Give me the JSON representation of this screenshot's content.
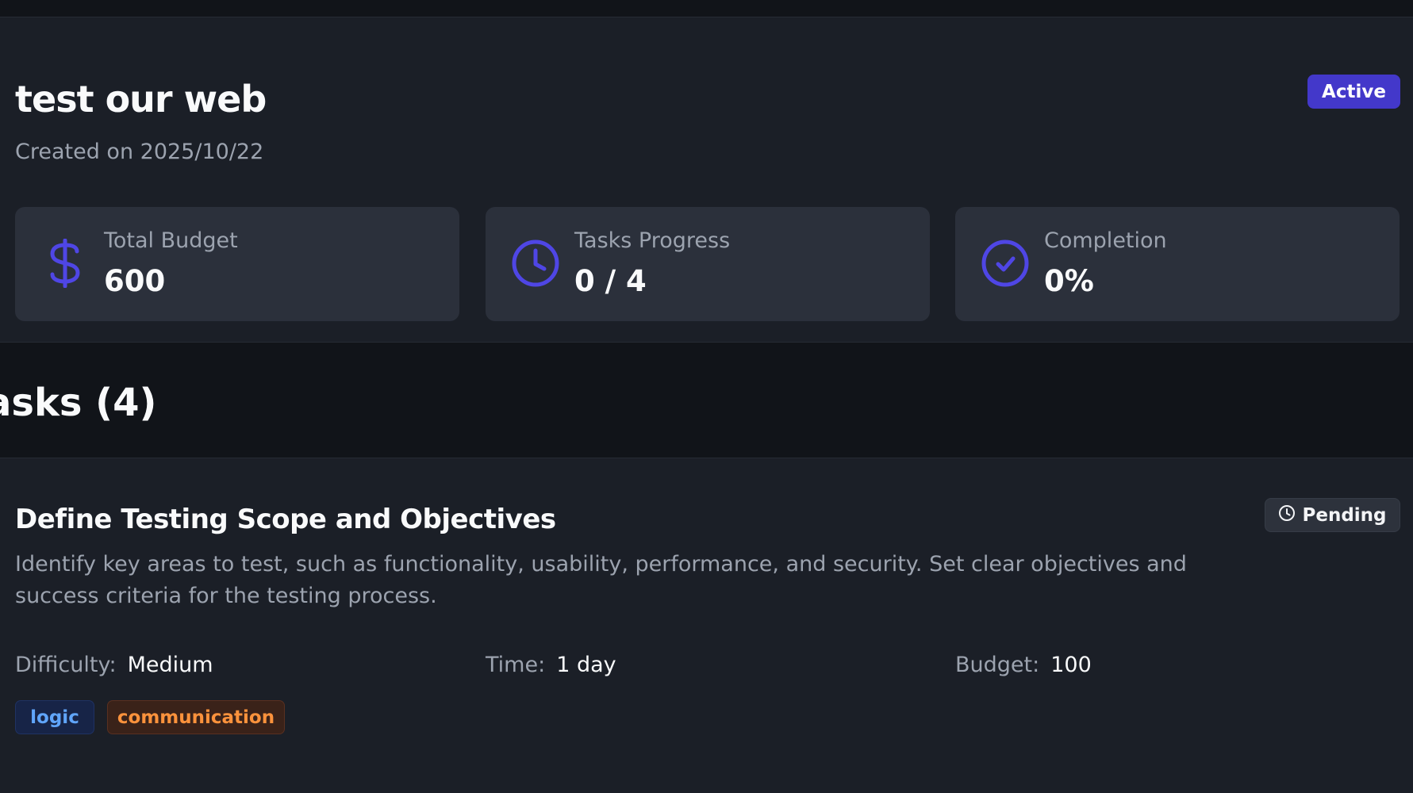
{
  "project": {
    "title": "test our web",
    "created": "Created on 2025/10/22",
    "status": "Active"
  },
  "stats": [
    {
      "icon": "dollar-icon",
      "label": "Total Budget",
      "value": "600"
    },
    {
      "icon": "clock-icon",
      "label": "Tasks Progress",
      "value": "0 / 4"
    },
    {
      "icon": "check-circle-icon",
      "label": "Completion",
      "value": "0%"
    }
  ],
  "tasks_heading": "asks (4)",
  "task": {
    "title": "Define Testing Scope and Objectives",
    "status": "Pending",
    "description": "Identify key areas to test, such as functionality, usability, performance, and security. Set clear objectives and success criteria for the testing process.",
    "difficulty_label": "Difficulty:",
    "difficulty": "Medium",
    "time_label": "Time:",
    "time": "1 day",
    "budget_label": "Budget:",
    "budget": "100",
    "tags": [
      "logic",
      "communication"
    ]
  },
  "colors": {
    "accent": "#4338ca",
    "icon": "#4f46e5",
    "tag_logic": "#60a5fa",
    "tag_communication": "#fb923c"
  }
}
